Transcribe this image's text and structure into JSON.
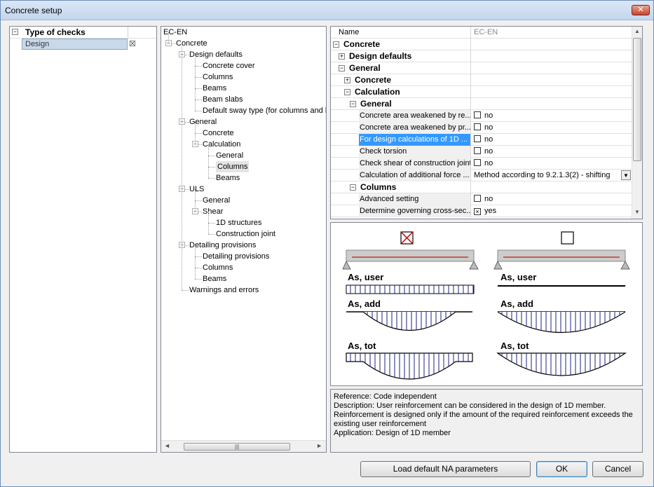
{
  "window": {
    "title": "Concrete setup",
    "close_icon": "close-icon"
  },
  "left_panel": {
    "header": "Type of checks",
    "item": "Design",
    "item_check": "☒"
  },
  "tree": {
    "root": "EC-EN",
    "nodes": [
      {
        "label": "Concrete",
        "level": 0,
        "toggle": "−"
      },
      {
        "label": "Design defaults",
        "level": 1,
        "toggle": "−"
      },
      {
        "label": "Concrete cover",
        "level": 2
      },
      {
        "label": "Columns",
        "level": 2
      },
      {
        "label": "Beams",
        "level": 2
      },
      {
        "label": "Beam slabs",
        "level": 2
      },
      {
        "label": "Default sway type (for columns and beams)",
        "level": 2
      },
      {
        "label": "General",
        "level": 1,
        "toggle": "−"
      },
      {
        "label": "Concrete",
        "level": 2
      },
      {
        "label": "Calculation",
        "level": 2,
        "toggle": "−"
      },
      {
        "label": "General",
        "level": 3
      },
      {
        "label": "Columns",
        "level": 3,
        "selected": true
      },
      {
        "label": "Beams",
        "level": 3
      },
      {
        "label": "ULS",
        "level": 1,
        "toggle": "−"
      },
      {
        "label": "General",
        "level": 2
      },
      {
        "label": "Shear",
        "level": 2,
        "toggle": "−"
      },
      {
        "label": "1D structures",
        "level": 3
      },
      {
        "label": "Construction joint",
        "level": 3
      },
      {
        "label": "Detailing provisions",
        "level": 1,
        "toggle": "−"
      },
      {
        "label": "Detailing provisions",
        "level": 2
      },
      {
        "label": "Columns",
        "level": 2
      },
      {
        "label": "Beams",
        "level": 2
      },
      {
        "label": "Warnings and errors",
        "level": 1
      }
    ],
    "scroll_grip": "|||"
  },
  "grid": {
    "header_name": "Name",
    "header_value": "EC-EN",
    "rows": [
      {
        "name": "Concrete",
        "indent": 0,
        "toggle": "−",
        "bold": true
      },
      {
        "name": "Design defaults",
        "indent": 1,
        "toggle": "+",
        "bold": true
      },
      {
        "name": "General",
        "indent": 1,
        "toggle": "−",
        "bold": true
      },
      {
        "name": "Concrete",
        "indent": 2,
        "toggle": "+",
        "bold": true
      },
      {
        "name": "Calculation",
        "indent": 2,
        "toggle": "−",
        "bold": true
      },
      {
        "name": "General",
        "indent": 3,
        "toggle": "−",
        "bold": true
      },
      {
        "name": "Concrete area weakened by re...",
        "indent": 4,
        "value": "no",
        "check": ""
      },
      {
        "name": "Concrete area weakened by pr...",
        "indent": 4,
        "value": "no",
        "check": ""
      },
      {
        "name": "For design calculations of 1D ...",
        "indent": 4,
        "value": "no",
        "check": "",
        "selected": true
      },
      {
        "name": "Check torsion",
        "indent": 4,
        "value": "no",
        "check": ""
      },
      {
        "name": "Check shear of construction joint",
        "indent": 4,
        "value": "no",
        "check": ""
      },
      {
        "name": "Calculation of additional force ...",
        "indent": 4,
        "value": "Method according to 9.2.1.3(2) - shifting",
        "dropdown": true
      },
      {
        "name": "Columns",
        "indent": 3,
        "toggle": "−",
        "bold": true
      },
      {
        "name": "Advanced setting",
        "indent": 4,
        "value": "no",
        "check": ""
      },
      {
        "name": "Determine governing cross-sec...",
        "indent": 4,
        "value": "yes",
        "check": "×"
      }
    ]
  },
  "picture": {
    "labels": [
      "As, user",
      "As, add",
      "As, tot"
    ]
  },
  "description": {
    "lines": [
      "Reference:  Code independent",
      "Description:  User reinforcement can be considered in the design of 1D member.",
      "Reinforcement is designed only if the amount of the required reinforcement exceeds the",
      "existing user reinforcement",
      "Application:  Design of 1D member"
    ]
  },
  "buttons": {
    "load_default": "Load default NA parameters",
    "ok": "OK",
    "cancel": "Cancel"
  }
}
